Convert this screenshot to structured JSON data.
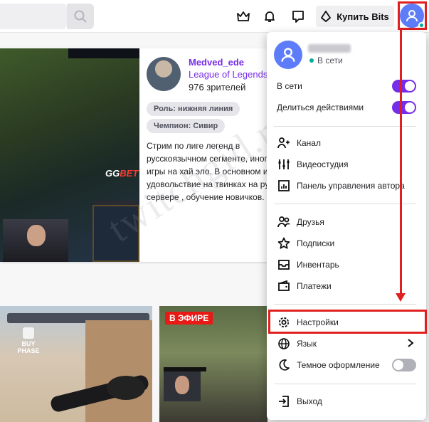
{
  "topbar": {
    "search_placeholder": "",
    "bits_label": "Купить Bits",
    "icons": [
      "search-icon",
      "crown-icon",
      "bell-icon",
      "whispers-icon",
      "bits-icon",
      "avatar-icon"
    ]
  },
  "featured": {
    "streamer": "Medved_ede",
    "game": "League of Legends",
    "viewers": "976 зрителей",
    "tags": [
      "Роль: нижняя линия",
      "Чемпион: Сивир"
    ],
    "description_lines": [
      "Стрим по лиге легенд в",
      "русскоязычном сегменте, иного",
      "игры на хай эло. В основном иг",
      "удовольствие на твинках на ру",
      "сервере , обучение новичков."
    ],
    "overlay_text": {
      "gg": "GG",
      "bet": "BET"
    }
  },
  "thumbs": {
    "buy_phase": "BUY PHASE",
    "live_badge": "В ЭФИРЕ"
  },
  "menu": {
    "status": "В сети",
    "toggles": [
      {
        "label": "В сети",
        "on": true
      },
      {
        "label": "Делиться действиями",
        "on": true
      }
    ],
    "creator_items": [
      "Канал",
      "Видеостудия",
      "Панель управления автора"
    ],
    "user_items": [
      "Друзья",
      "Подписки",
      "Инвентарь",
      "Платежи"
    ],
    "settings": "Настройки",
    "language": "Язык",
    "dark_theme": {
      "label": "Темное оформление",
      "on": false
    },
    "logout": "Выход"
  },
  "watermark": "twitchgid.ru",
  "colors": {
    "accent": "#772ce8",
    "highlight": "#e02020",
    "avatar": "#5c7cfa",
    "online": "#00ad96",
    "live": "#e91916"
  }
}
